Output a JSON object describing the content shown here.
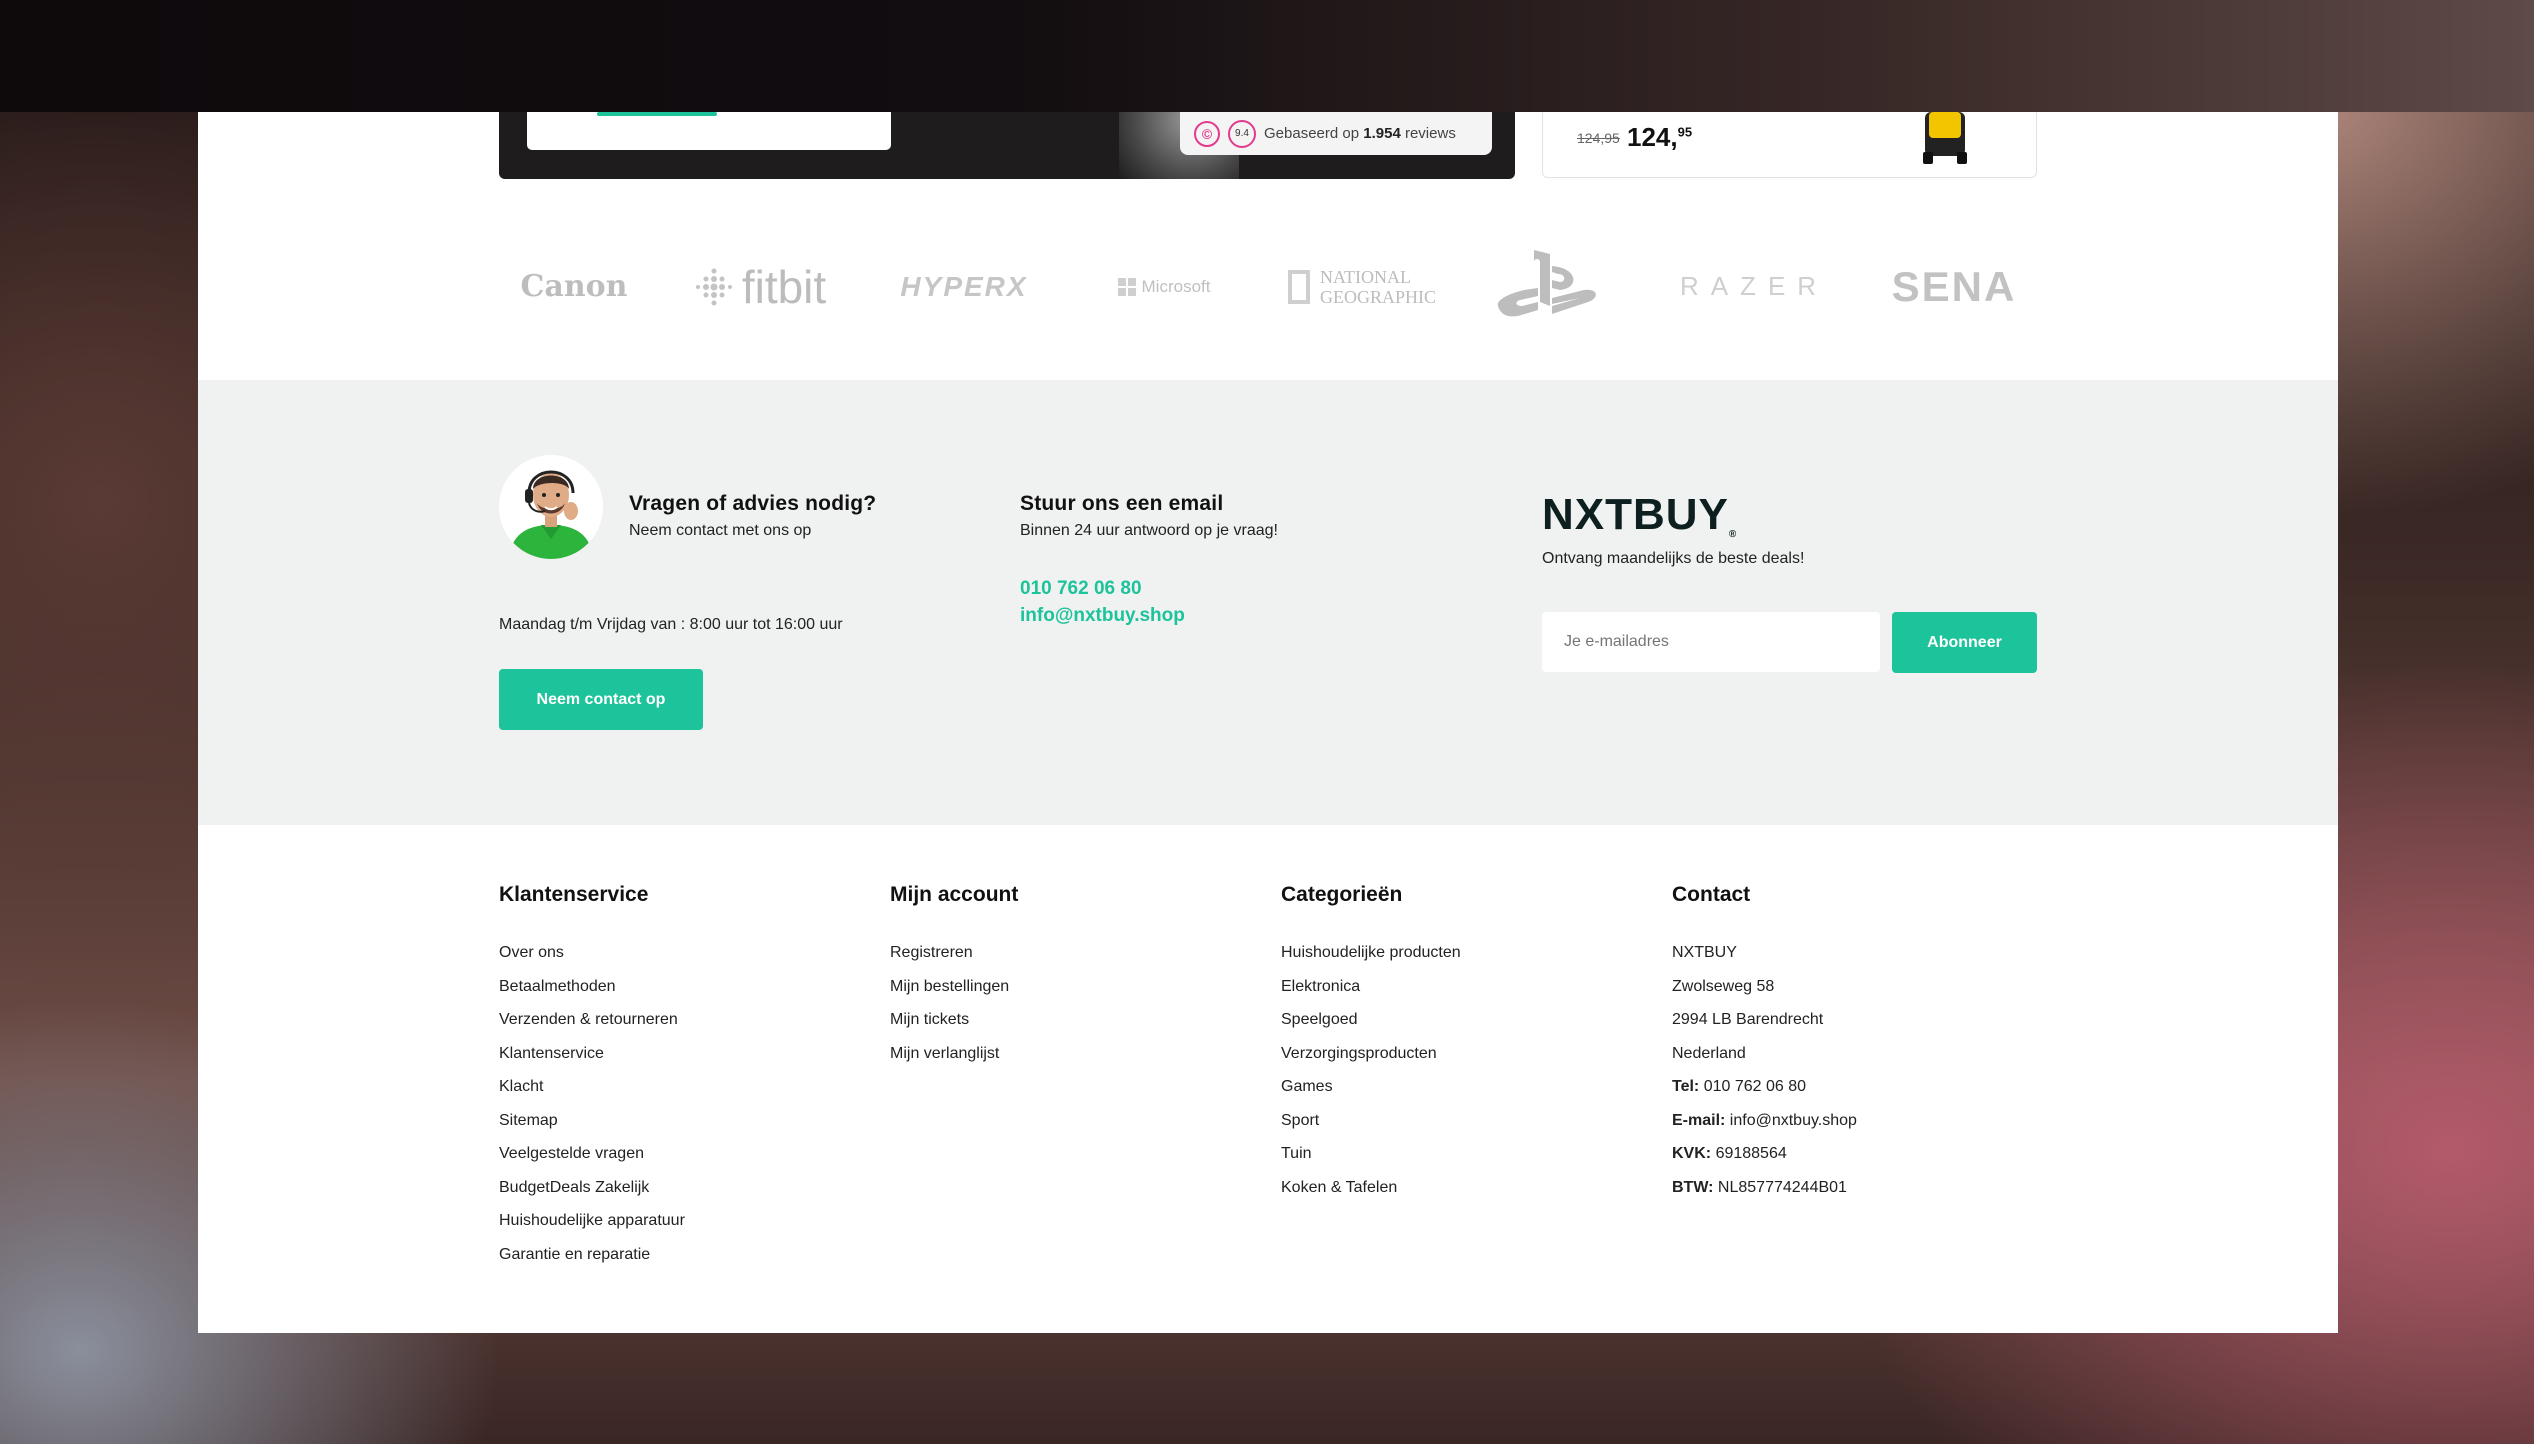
{
  "promo": {
    "reviews_prefix": "Gebaseerd op",
    "reviews_count": "1.954",
    "reviews_suffix": "reviews",
    "rating_score": "9.4"
  },
  "product": {
    "old_price": "124,95",
    "new_price_main": "124,",
    "new_price_cents": "95"
  },
  "brands": [
    "Canon",
    "fitbit",
    "HYPERX",
    "Microsoft",
    "NATIONAL GEOGRAPHIC",
    "PlayStation",
    "RAZER",
    "SENA"
  ],
  "contact": {
    "advice_title": "Vragen of advies nodig?",
    "advice_sub": "Neem contact met ons op",
    "hours": "Maandag t/m Vrijdag van : 8:00 uur tot 16:00 uur",
    "contact_button": "Neem contact op",
    "email_title": "Stuur ons een email",
    "email_sub": "Binnen 24 uur antwoord op je vraag!",
    "phone": "010 762 06 80",
    "email": "info@nxtbuy.shop"
  },
  "newsletter": {
    "logo": "NXTBUY",
    "tagline": "Ontvang maandelijks de beste deals!",
    "placeholder": "Je e-mailadres",
    "button": "Abonneer"
  },
  "footer": {
    "klantenservice": {
      "title": "Klantenservice",
      "items": [
        "Over ons",
        "Betaalmethoden",
        "Verzenden & retourneren",
        "Klantenservice",
        "Klacht",
        "Sitemap",
        "Veelgestelde vragen",
        "BudgetDeals Zakelijk",
        "Huishoudelijke apparatuur",
        "Garantie en reparatie"
      ]
    },
    "account": {
      "title": "Mijn account",
      "items": [
        "Registreren",
        "Mijn bestellingen",
        "Mijn tickets",
        "Mijn verlanglijst"
      ]
    },
    "categorieen": {
      "title": "Categorieën",
      "items": [
        "Huishoudelijke producten",
        "Elektronica",
        "Speelgoed",
        "Verzorgingsproducten",
        "Games",
        "Sport",
        "Tuin",
        "Koken & Tafelen"
      ]
    },
    "contact": {
      "title": "Contact",
      "company": "NXTBUY",
      "street": "Zwolseweg 58",
      "city": "2994 LB Barendrecht",
      "country": "Nederland",
      "tel_label": "Tel:",
      "tel": "010 762 06 80",
      "email_label": "E-mail:",
      "email": "info@nxtbuy.shop",
      "kvk_label": "KVK:",
      "kvk": "69188564",
      "btw_label": "BTW:",
      "btw": "NL857774244B01"
    }
  }
}
